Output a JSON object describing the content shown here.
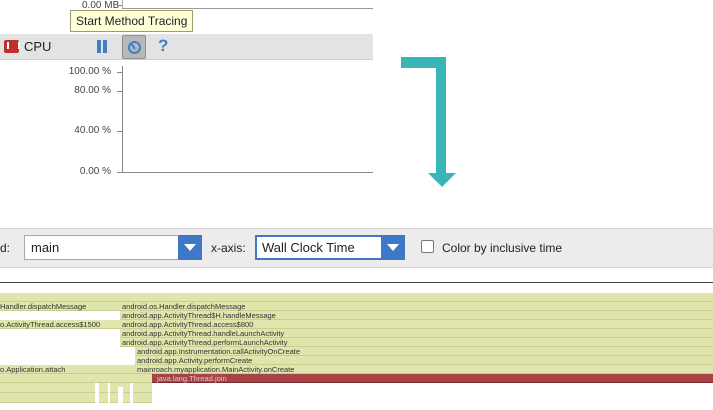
{
  "tooltip": {
    "text": "Start Method Tracing"
  },
  "memory": {
    "axis_label": "0.00 MB"
  },
  "cpu_monitor": {
    "label": "CPU",
    "pause_icon": "pause-icon",
    "trace_icon": "method-trace-icon",
    "help_label": "?",
    "y_ticks": [
      "100.00 %",
      "80.00 %",
      "40.00 %",
      "0.00 %"
    ]
  },
  "toolbar": {
    "thread_label": "d:",
    "thread_value": "main",
    "xaxis_label": "x-axis:",
    "xaxis_value": "Wall Clock Time",
    "color_label": "Color by inclusive time"
  },
  "trace": {
    "left_labels": [
      "Handler.dispatchMessage",
      "o.ActivityThread.access$1500",
      "o.Application.attach"
    ],
    "labels": [
      "android.os.Handler.dispatchMessage",
      "android.app.ActivityThread$H.handleMessage",
      "android.app.ActivityThread.access$800",
      "android.app.ActivityThread.handleLaunchActivity",
      "android.app.ActivityThread.performLaunchActivity",
      "android.app.Instrumentation.callActivityOnCreate",
      "android.app.Activity.performCreate",
      "mainroach.myapplication.MainActivity.onCreate",
      "java.lang.Thread.join"
    ]
  },
  "colors": {
    "accent": "#3e78c6",
    "arrow": "#3ab5b7",
    "bar": "#dfe5ad",
    "bar_hot": "#a54347"
  }
}
